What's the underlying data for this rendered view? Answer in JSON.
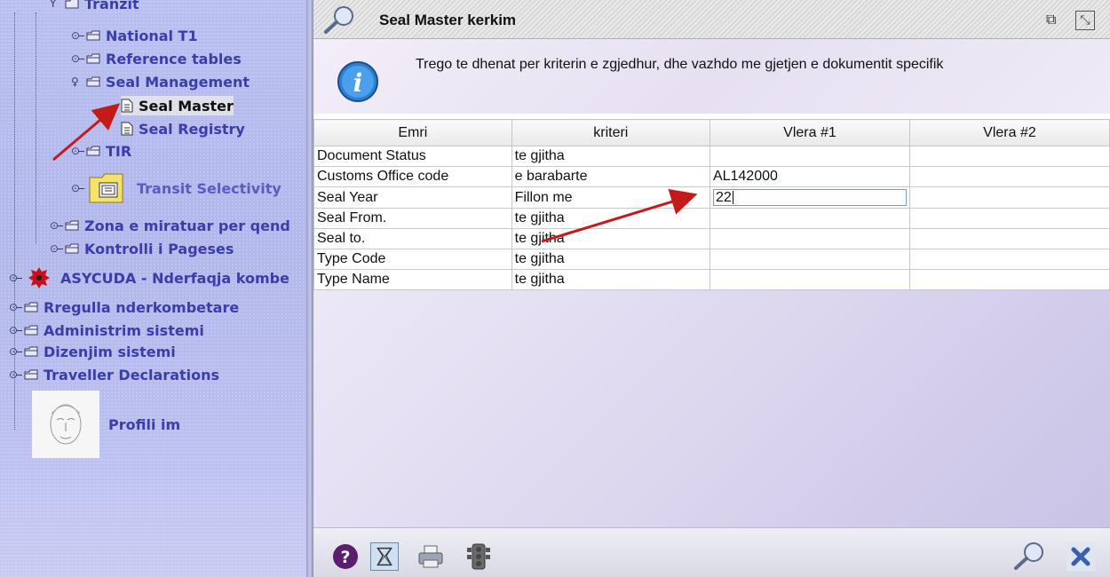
{
  "tree": {
    "items": [
      {
        "label": "Tranzit"
      },
      {
        "label": "National T1"
      },
      {
        "label": "Reference tables"
      },
      {
        "label": "Seal Management"
      },
      {
        "label": "Seal Master"
      },
      {
        "label": "Seal Registry"
      },
      {
        "label": "TIR"
      },
      {
        "label": "Transit Selectivity"
      },
      {
        "label": "Zona e miratuar per qend"
      },
      {
        "label": "Kontrolli i Pageses"
      },
      {
        "label": "ASYCUDA - Nderfaqja kombe"
      },
      {
        "label": "Rregulla nderkombetare"
      },
      {
        "label": "Administrim sistemi"
      },
      {
        "label": "Dizenjim sistemi"
      },
      {
        "label": "Traveller Declarations"
      },
      {
        "label": "Profili im"
      }
    ]
  },
  "window": {
    "title": "Seal Master kerkim",
    "info": "Trego te dhenat per kriterin e zgjedhur, dhe vazhdo me gjetjen e dokumentit specifik"
  },
  "table": {
    "headers": [
      "Emri",
      "kriteri",
      "Vlera #1",
      "Vlera #2"
    ],
    "rows": [
      {
        "name": "Document Status",
        "criteria": "te gjitha",
        "v1": "",
        "v2": ""
      },
      {
        "name": "Customs Office code",
        "criteria": "e barabarte",
        "v1": "AL142000",
        "v2": ""
      },
      {
        "name": "Seal Year",
        "criteria": "Fillon me",
        "v1": "22",
        "v2": ""
      },
      {
        "name": "Seal From.",
        "criteria": "te gjitha",
        "v1": "",
        "v2": ""
      },
      {
        "name": "Seal to.",
        "criteria": "te gjitha",
        "v1": "",
        "v2": ""
      },
      {
        "name": "Type Code",
        "criteria": "te gjitha",
        "v1": "",
        "v2": ""
      },
      {
        "name": "Type Name",
        "criteria": "te gjitha",
        "v1": "",
        "v2": ""
      }
    ]
  },
  "toolbar": {
    "icons": [
      "help-icon",
      "filter-icon",
      "print-icon",
      "traffic-light-icon",
      "search-icon",
      "close-icon"
    ]
  },
  "colors": {
    "tree_bg": "#b5baee",
    "tree_text": "#4a4cb8",
    "arrow": "#c41a1a"
  }
}
